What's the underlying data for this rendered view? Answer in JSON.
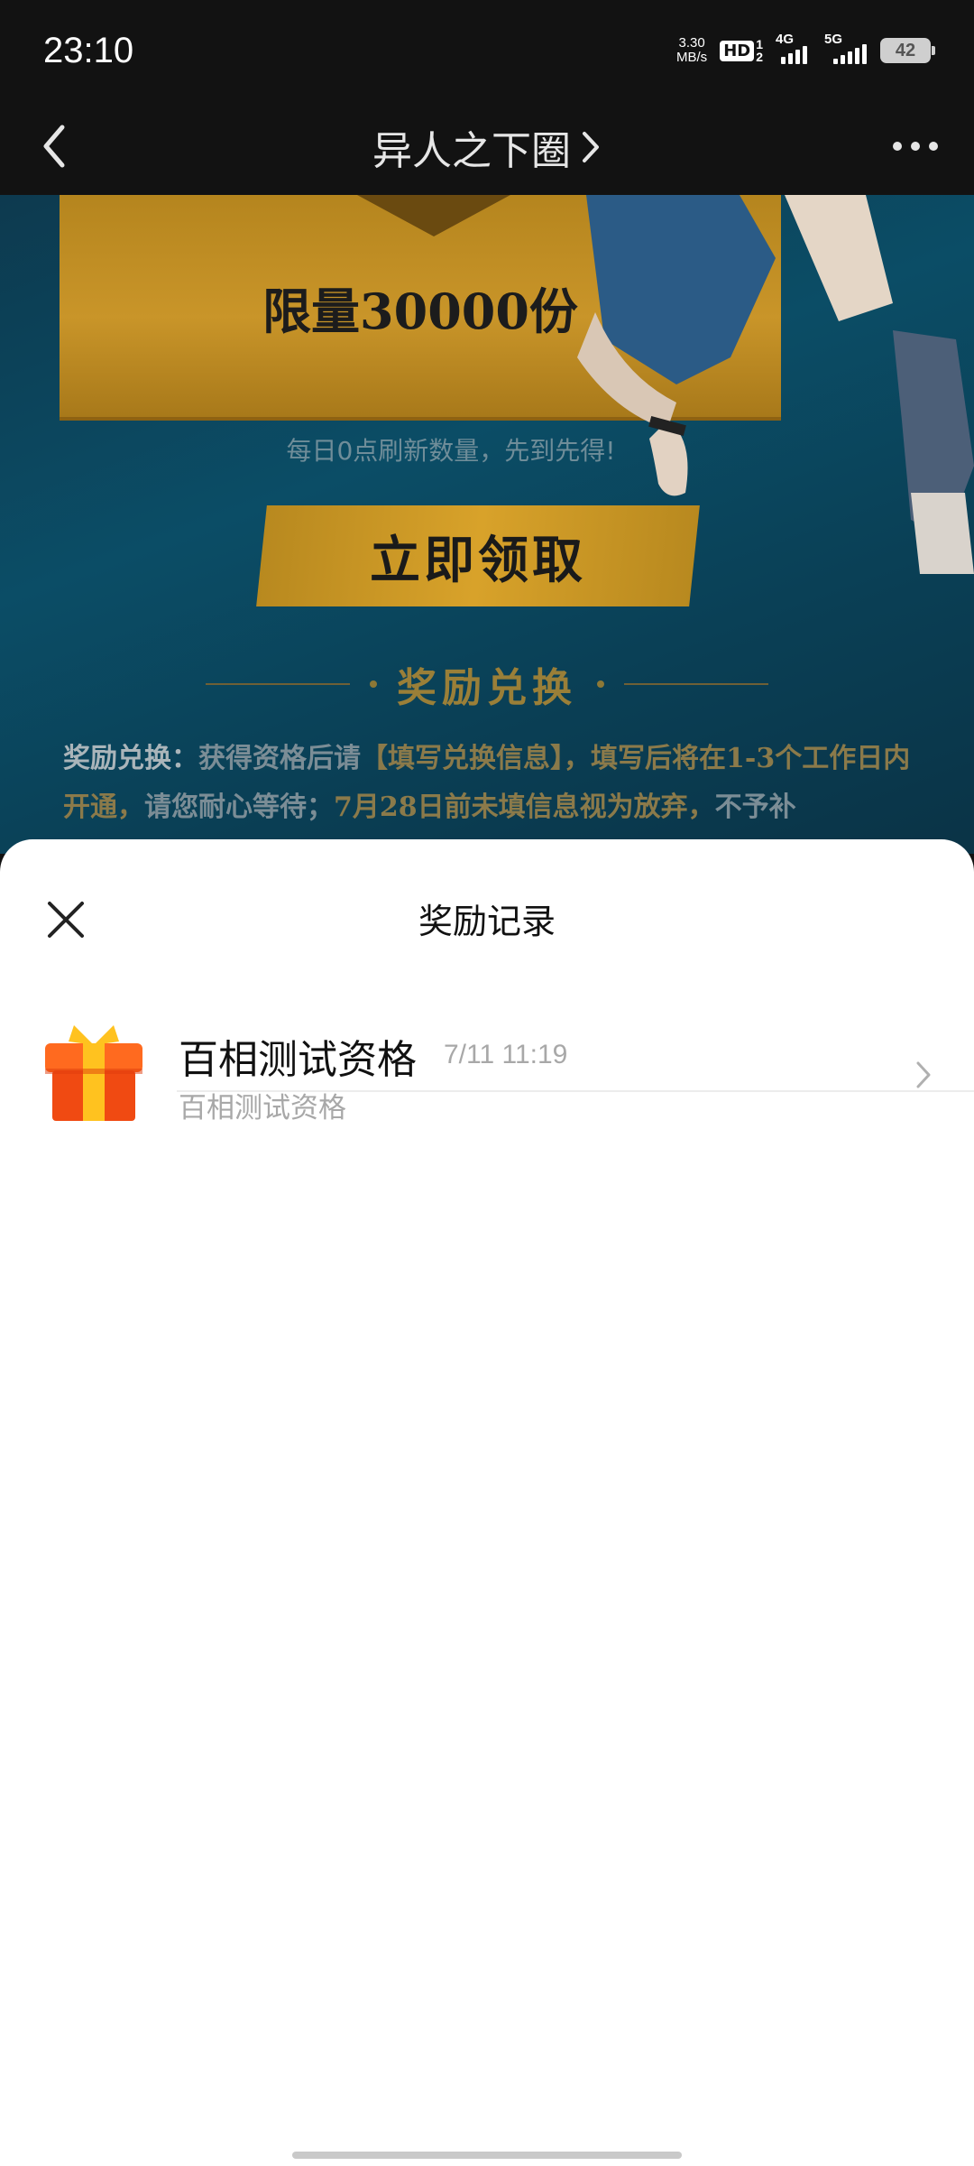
{
  "status_bar": {
    "time": "23:10",
    "net_speed_value": "3.30",
    "net_speed_unit": "MB/s",
    "hd_label": "HD",
    "sim_numbers": "1\n2",
    "signal_1_label": "4G",
    "signal_2_label": "5G",
    "battery_level": "42",
    "icons": [
      "hd-icon",
      "signal-4g-icon",
      "signal-5g-icon",
      "battery-icon"
    ]
  },
  "nav": {
    "title": "异人之下圈",
    "icons": [
      "back-arrow-icon",
      "chevron-right-icon",
      "more-dots-icon"
    ]
  },
  "background_page": {
    "limit_text": "限量30000份",
    "refresh_note": "每日0点刷新数量，先到先得!",
    "claim_button": "立即领取",
    "section_heading": "奖励兑换",
    "rule_lead": "奖励兑换：",
    "rule_part1": "获得资格后请",
    "rule_highlight1": "【填写兑换信息】，填写后将在1-3个工作日内开通，",
    "rule_part2": "请您耐心等待；",
    "rule_highlight2": "7月28日前未填信息视为放弃，",
    "rule_part3": "不予补",
    "accent_color": "#c99529"
  },
  "sheet": {
    "title": "奖励记录",
    "close_icon": "close-icon",
    "records": [
      {
        "title": "百相测试资格",
        "time": "7/11 11:19",
        "subtitle": "百相测试资格",
        "icon": "gift-icon",
        "arrow_icon": "chevron-right-icon"
      }
    ]
  }
}
